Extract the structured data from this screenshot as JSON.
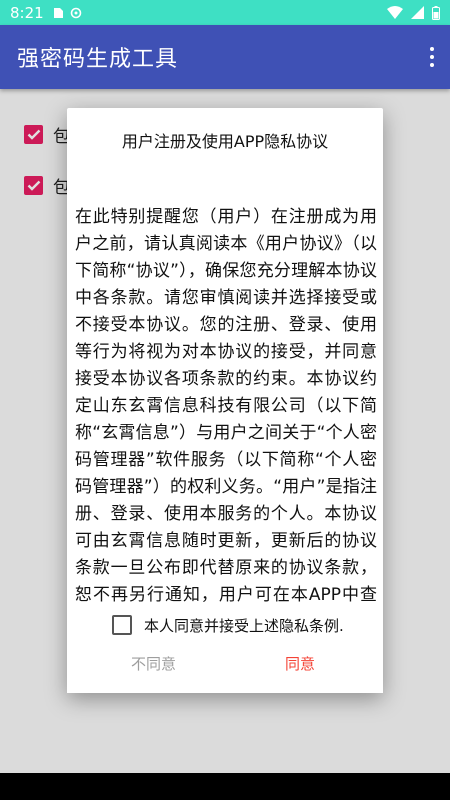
{
  "status_bar": {
    "time": "8:21",
    "icons": [
      "sim-icon",
      "sync-icon",
      "wifi-icon",
      "signal-icon",
      "battery-icon"
    ],
    "color": "#3ee0c4"
  },
  "app_bar": {
    "title": "强密码生成工具",
    "color": "#3f51b5",
    "menu_icon": "more-vert-icon"
  },
  "background": {
    "checkbox_1_label": "包",
    "checkbox_2_label": "包",
    "accent": "#e91e63"
  },
  "dialog": {
    "title": "用户注册及使用APP隐私协议",
    "body": "在此特别提醒您（用户）在注册成为用户之前，请认真阅读本《用户协议》（以下简称“协议”），确保您充分理解本协议中各条款。请您审慎阅读并选择接受或不接受本协议。您的注册、登录、使用等行为将视为对本协议的接受，并同意接受本协议各项条款的约束。本协议约定山东玄霄信息科技有限公司（以下简称“玄霄信息”）与用户之间关于“个人密码管理器”软件服务（以下简称“个人密码管理器”）的权利义务。“用户”是指注册、登录、使用本服务的个人。本协议可由玄霄信息随时更新，更新后的协议条款一旦公布即代替原来的协议条款，恕不再另行通知，用户可在本APP中查阅最新版协议条",
    "agree_checkbox_label": "本人同意并接受上述隐私条例.",
    "agree_checked": false,
    "disagree_label": "不同意",
    "agree_label": "同意",
    "agree_color": "#f44336"
  }
}
